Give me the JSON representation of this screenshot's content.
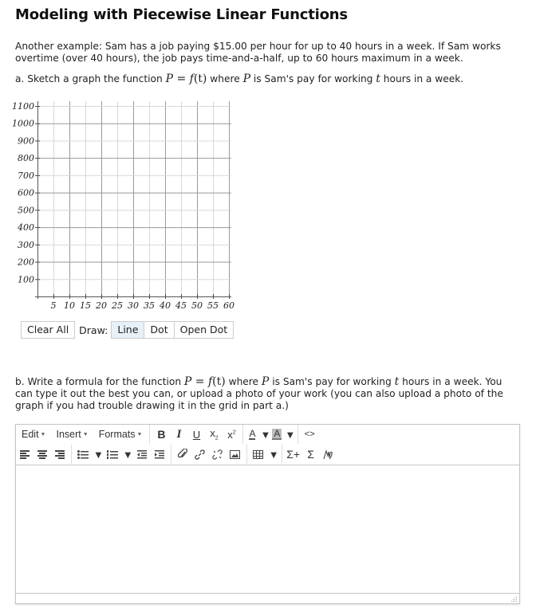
{
  "page": {
    "title": "Modeling with Piecewise Linear Functions",
    "intro_line1": "Another example: Sam has a job paying $15.00 per hour for up to 40 hours in a week. If Sam works",
    "intro_line2": "overtime (over 40 hours), the job pays time-and-a-half, up to 60 hours maximum in a week.",
    "part_a": {
      "prefix": "a. Sketch a graph the function ",
      "math_P": "P",
      "math_eq": " = ",
      "math_f": "f",
      "math_t_paren": "(t)",
      "mid": " where ",
      "mid2": " is Sam's pay for working ",
      "math_t": "t",
      "suffix": " hours in a week."
    },
    "part_b": {
      "prefix": "b. Write a formula for the function ",
      "math_P": "P",
      "math_eq": " = ",
      "math_f": "f",
      "math_t_paren": "(t)",
      "mid": " where ",
      "mid2": " is Sam's pay for working ",
      "math_t": "t",
      "suffix": " hours in a week. You can type it out the best you can, or upload a photo of your work (you can also upload a photo of the graph if you had trouble drawing it in the grid in part a.)"
    }
  },
  "chart_data": {
    "type": "scatter",
    "title": "",
    "xlabel": "",
    "ylabel": "",
    "x_ticks": [
      5,
      10,
      15,
      20,
      25,
      30,
      35,
      40,
      45,
      50,
      55,
      60
    ],
    "x_tick_labels": [
      "5",
      "10",
      "15",
      "20",
      "25",
      "30",
      "35",
      "40",
      "45",
      "50",
      "55",
      "60"
    ],
    "y_ticks": [
      100,
      200,
      300,
      400,
      500,
      600,
      700,
      800,
      900,
      1000,
      1100
    ],
    "y_tick_labels": [
      "100",
      "200",
      "300",
      "400",
      "500",
      "600",
      "700",
      "800",
      "900",
      "1000",
      "1100"
    ],
    "xlim": [
      0,
      60
    ],
    "ylim": [
      0,
      1100
    ],
    "grid": true,
    "series": []
  },
  "graph_controls": {
    "clear_all": "Clear All",
    "draw_label": "Draw:",
    "modes": [
      "Line",
      "Dot",
      "Open Dot"
    ],
    "active_mode": "Line"
  },
  "editor": {
    "menus": [
      "Edit",
      "Insert",
      "Formats"
    ],
    "toolbar_row1": [
      "bold",
      "italic",
      "underline",
      "subscript",
      "superscript",
      "text-color",
      "background-color",
      "source-code"
    ],
    "toolbar_row2": [
      "align-left",
      "align-center",
      "align-right",
      "bullet-list",
      "numbered-list",
      "outdent",
      "indent",
      "attach",
      "link",
      "unlink",
      "image",
      "table",
      "equation-add",
      "sum",
      "handwriting"
    ],
    "labels": {
      "bold": "B",
      "italic": "I",
      "underline": "U",
      "subscript": "x",
      "superscript": "x",
      "text_color": "A",
      "bg_color": "A",
      "code": "<>",
      "sum_plus": "Σ+",
      "sum": "Σ"
    },
    "content": ""
  },
  "colors": {
    "grid_major": "#999999",
    "grid_minor": "#dddddd",
    "active_button_bg": "#e8f0f8",
    "editor_border": "#c5c5c5"
  }
}
